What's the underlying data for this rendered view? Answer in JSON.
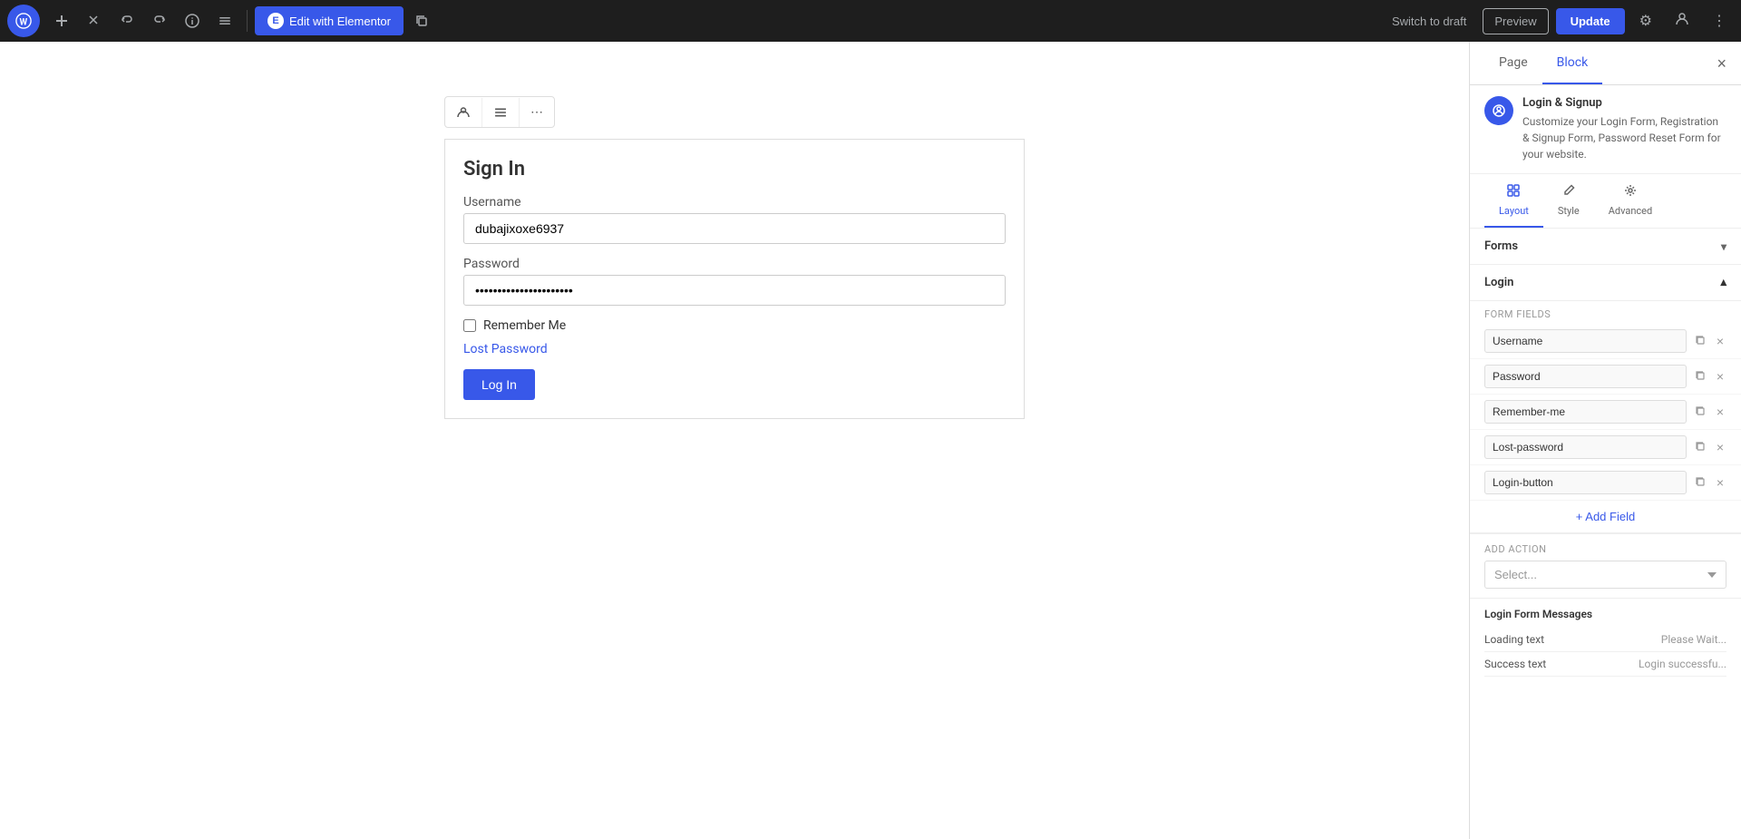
{
  "toolbar": {
    "wp_logo": "W",
    "add_label": "+",
    "edit_label": "✏",
    "undo_label": "↩",
    "redo_label": "↪",
    "info_label": "ℹ",
    "list_label": "≡",
    "edit_elementor_label": "Edit with Elementor",
    "elementor_icon": "E",
    "copy_label": "⧉",
    "switch_to_draft_label": "Switch to draft",
    "preview_label": "Preview",
    "update_label": "Update",
    "settings_label": "⚙",
    "user_label": "👤",
    "more_label": "⋮"
  },
  "block_toolbar": {
    "person_icon": "👤",
    "menu_icon": "≡",
    "more_icon": "⋯"
  },
  "form": {
    "title": "Sign In",
    "username_label": "Username",
    "username_value": "dubajixoxe6937",
    "password_label": "Password",
    "password_value": "••••••••••••••••••••••",
    "remember_label": "Remember Me",
    "lost_password_label": "Lost Password",
    "login_button_label": "Log In"
  },
  "right_panel": {
    "tab_page": "Page",
    "tab_block": "Block",
    "close_label": "×",
    "plugin_icon": "⊕",
    "plugin_title": "Login & Signup",
    "plugin_description": "Customize your Login Form, Registration & Signup Form, Password Reset Form for your website.",
    "sub_tabs": [
      {
        "id": "layout",
        "icon": "⊞",
        "label": "Layout"
      },
      {
        "id": "style",
        "icon": "✏",
        "label": "Style"
      },
      {
        "id": "advanced",
        "icon": "⚙",
        "label": "Advanced"
      }
    ],
    "forms_section": "Forms",
    "login_section": "Login",
    "form_fields_label": "Form Fields",
    "fields": [
      {
        "name": "Username"
      },
      {
        "name": "Password"
      },
      {
        "name": "Remember-me"
      },
      {
        "name": "Lost-password"
      },
      {
        "name": "Login-button"
      }
    ],
    "add_field_label": "+ Add Field",
    "add_action_label": "Add Action",
    "action_placeholder": "Select...",
    "login_form_messages": "Login Form Messages",
    "loading_text_label": "Loading text",
    "loading_text_value": "Please Wait...",
    "success_text_label": "Success text",
    "success_text_value": "Login successfu..."
  }
}
